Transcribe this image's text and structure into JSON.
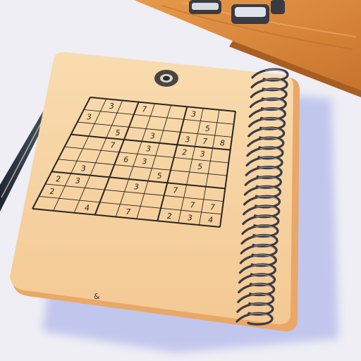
{
  "scene": {
    "description_free": true,
    "colors": {
      "background": "#eeeef4",
      "desk_wood": "#d88a3e",
      "notepad_paper": "#f7d3a0",
      "notepad_edge": "#e9a867",
      "grid_ink": "#2a2622",
      "spiral_wire": "#3c3c44",
      "pencil_body": "#2f3b4a"
    },
    "icons": {
      "hole": "punch-hole-icon",
      "spiral": "spiral-binding-icon",
      "pencil": "pencil-icon",
      "clips": "binder-clip-icon"
    }
  },
  "sudoku": {
    "size": 9,
    "rows": [
      [
        "",
        "3",
        "",
        "7",
        "",
        "",
        "3",
        "",
        ""
      ],
      [
        "3",
        "",
        "",
        "",
        "",
        "",
        "",
        "5",
        ""
      ],
      [
        "",
        "",
        "5",
        "",
        "3",
        "",
        "3",
        "7",
        "8"
      ],
      [
        "",
        "",
        "7",
        "",
        "3",
        "",
        "2",
        "3",
        ""
      ],
      [
        "",
        "",
        "",
        "6",
        "3",
        "",
        "",
        "5",
        ""
      ],
      [
        "",
        "3",
        "",
        "",
        "",
        "5",
        "",
        "",
        ""
      ],
      [
        "2",
        "3",
        "",
        "",
        "3",
        "",
        "7",
        "",
        ""
      ],
      [
        "2",
        "",
        "",
        "",
        "",
        "",
        "",
        "7",
        "7"
      ],
      [
        "",
        "",
        "4",
        "",
        "7",
        "",
        "2",
        "3",
        "4"
      ]
    ]
  },
  "page_mark": "&"
}
